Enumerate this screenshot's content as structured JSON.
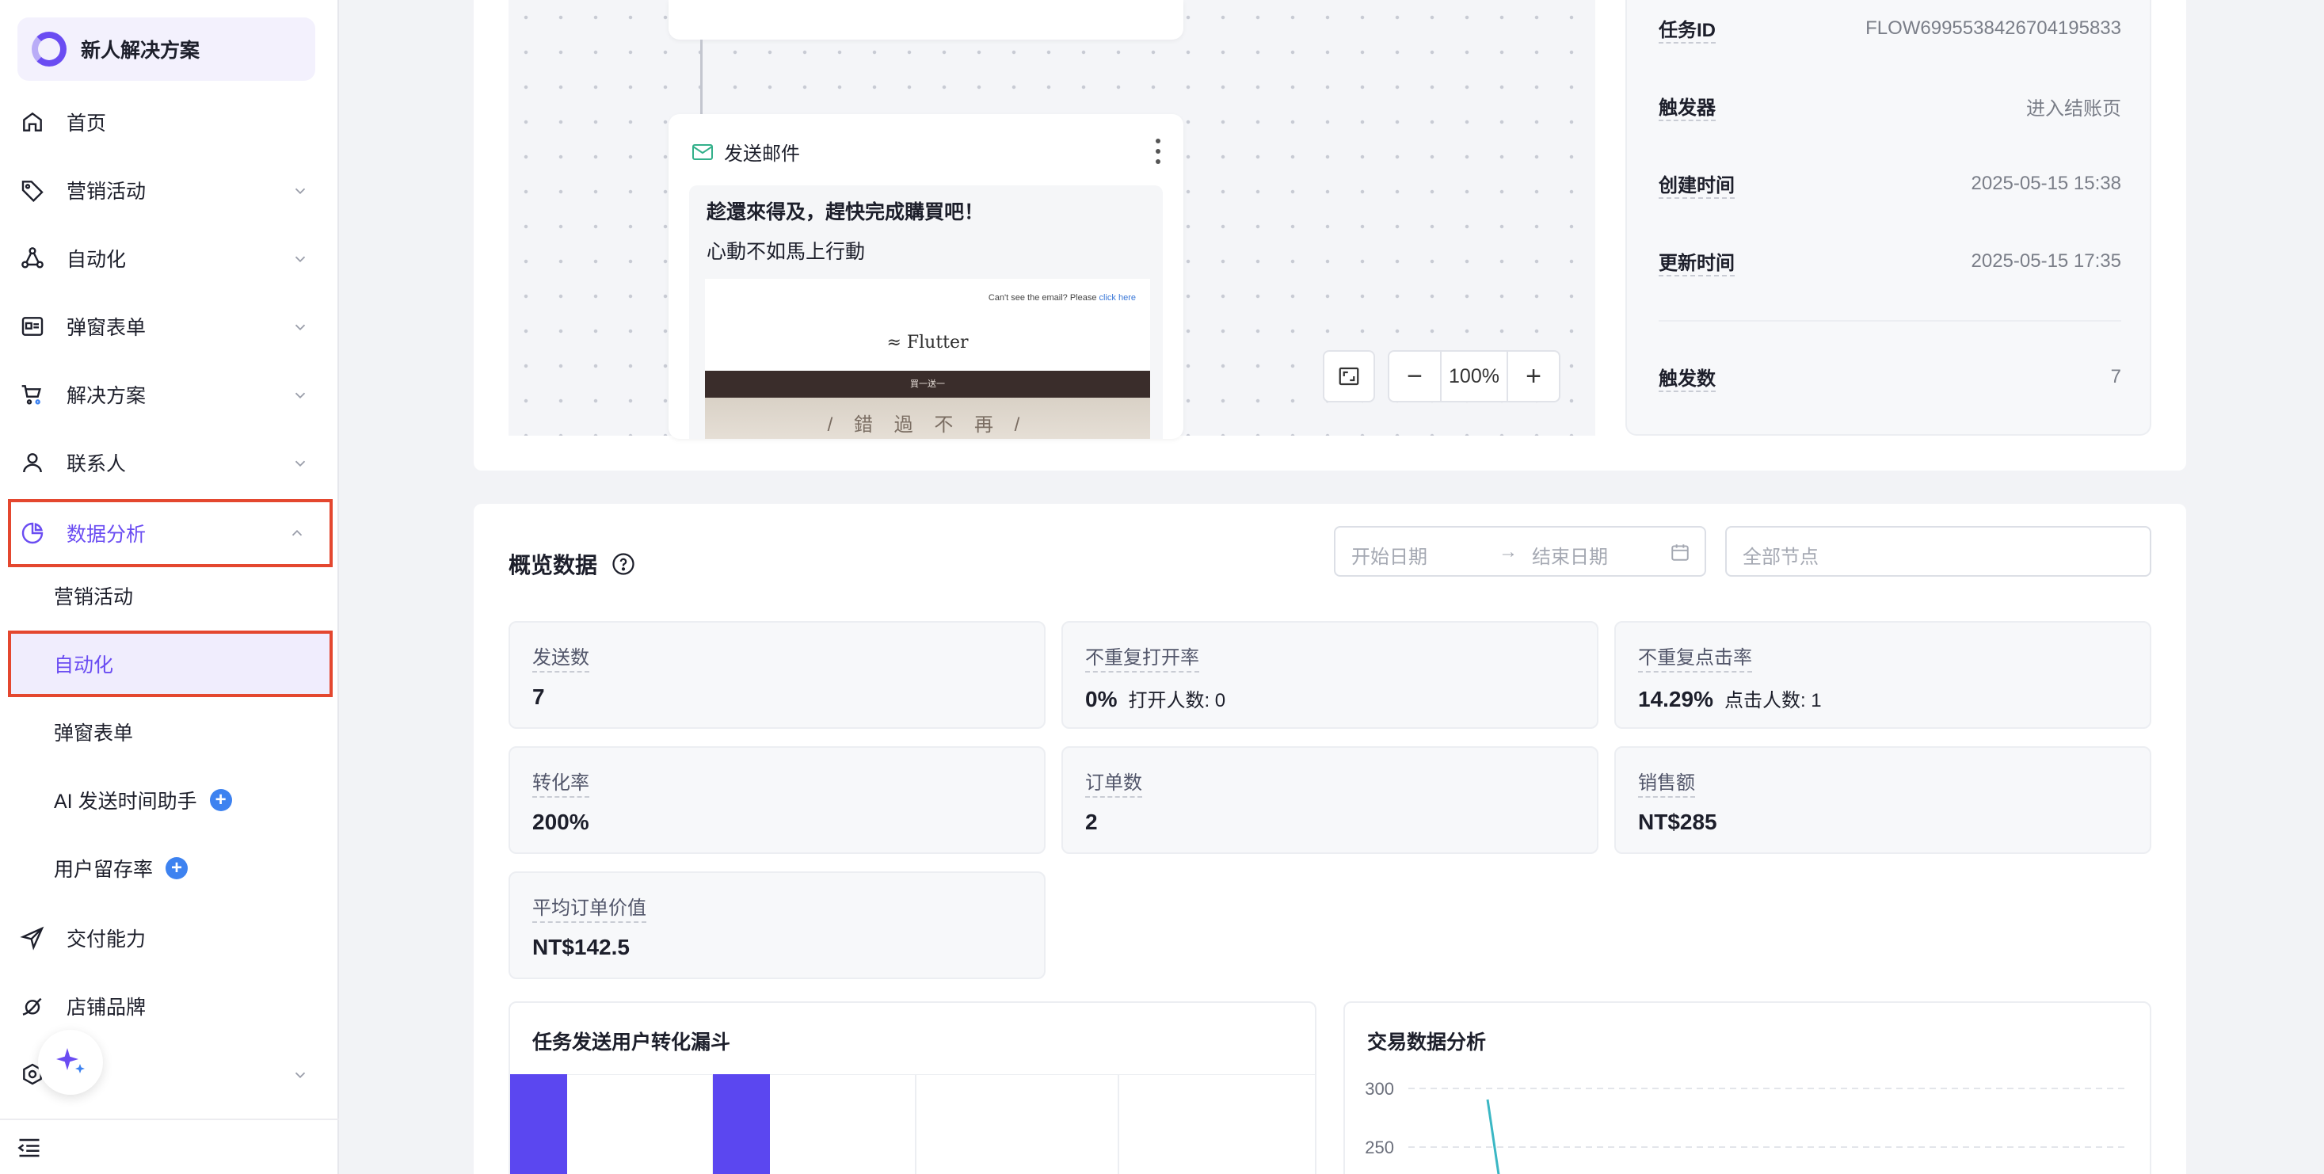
{
  "sidebar": {
    "brand": "新人解决方案",
    "items": [
      {
        "label": "首页"
      },
      {
        "label": "营销活动"
      },
      {
        "label": "自动化"
      },
      {
        "label": "弹窗表单"
      },
      {
        "label": "解决方案"
      },
      {
        "label": "联系人"
      },
      {
        "label": "数据分析"
      }
    ],
    "sub_items": [
      {
        "label": "营销活动"
      },
      {
        "label": "自动化"
      },
      {
        "label": "弹窗表单"
      },
      {
        "label": "AI 发送时间助手"
      },
      {
        "label": "用户留存率"
      }
    ],
    "bottom_items": [
      {
        "label": "交付能力"
      },
      {
        "label": "店铺品牌"
      }
    ],
    "partial_item_label": "...",
    "accent": "#6a4cf2",
    "highlight": "#e4472f"
  },
  "flow": {
    "email_node": {
      "title": "发送邮件",
      "subject": "趁還來得及，趕快完成購買吧！",
      "preheader": "心動不如馬上行動",
      "preview": {
        "top_text": "Can't see the email? Please",
        "top_link": "click here",
        "logo": "Flutter",
        "banner": "買一送一",
        "hero": "/ 錯 過 不 再 /"
      }
    },
    "zoom": {
      "value": "100%",
      "minus": "−",
      "plus": "+"
    }
  },
  "info": {
    "rows": [
      {
        "key": "任务ID",
        "value": "FLOW6995538426704195833"
      },
      {
        "key": "触发器",
        "value": "进入结账页"
      },
      {
        "key": "创建时间",
        "value": "2025-05-15 15:38"
      },
      {
        "key": "更新时间",
        "value": "2025-05-15 17:35"
      }
    ],
    "trigger_count": {
      "key": "触发数",
      "value": "7"
    }
  },
  "overview": {
    "title": "概览数据",
    "date_start_placeholder": "开始日期",
    "date_arrow": "→",
    "date_end_placeholder": "结束日期",
    "node_placeholder": "全部节点",
    "metrics": [
      {
        "label": "发送数",
        "value": "7",
        "sub": ""
      },
      {
        "label": "不重复打开率",
        "value": "0%",
        "sub": "打开人数: 0"
      },
      {
        "label": "不重复点击率",
        "value": "14.29%",
        "sub": "点击人数: 1"
      },
      {
        "label": "转化率",
        "value": "200%",
        "sub": ""
      },
      {
        "label": "订单数",
        "value": "2",
        "sub": ""
      },
      {
        "label": "销售额",
        "value": "NT$285",
        "sub": ""
      },
      {
        "label": "平均订单价值",
        "value": "NT$142.5",
        "sub": ""
      }
    ]
  },
  "charts": {
    "funnel_title": "任务发送用户转化漏斗",
    "trade_title": "交易数据分析"
  },
  "chart_data": [
    {
      "type": "bar",
      "title": "任务发送用户转化漏斗",
      "categories": [],
      "values": [],
      "bar_color": "#5b47f0"
    },
    {
      "type": "line",
      "title": "交易数据分析",
      "yticks": [
        300,
        250
      ],
      "line_color": "#3bb7c4"
    }
  ]
}
